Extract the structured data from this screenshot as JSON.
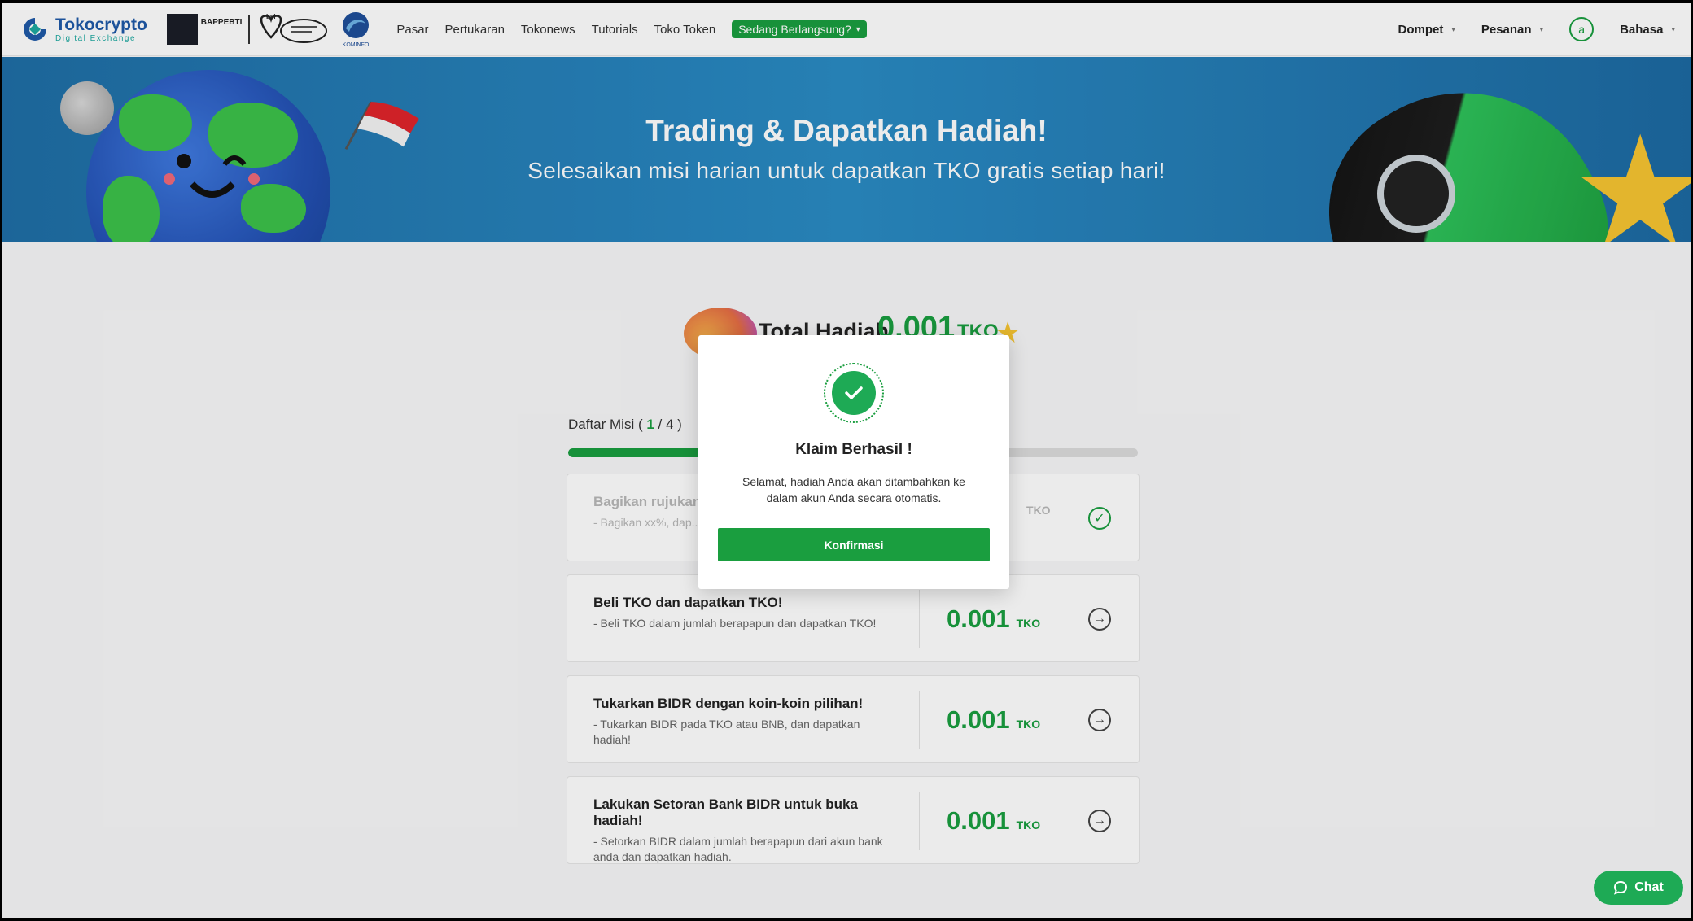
{
  "brand": {
    "name": "Tokocrypto",
    "subtitle": "Digital Exchange",
    "partner_bappebti": "BAPPEBTI",
    "partner_bsi": "bsi",
    "partner_kominfo": "KOMINFO"
  },
  "nav": {
    "links": [
      "Pasar",
      "Pertukaran",
      "Tokonews",
      "Tutorials",
      "Toko Token"
    ],
    "live_pill": "Sedang Berlangsung?",
    "wallet": "Dompet",
    "orders": "Pesanan",
    "avatar_letter": "a",
    "language": "Bahasa"
  },
  "banner": {
    "title": "Trading & Dapatkan Hadiah!",
    "subtitle": "Selesaikan misi harian untuk dapatkan TKO gratis setiap hari!"
  },
  "total": {
    "label": "Total Hadiah",
    "value": "0.001",
    "unit": "TKO"
  },
  "missions": {
    "count_label": "Daftar Misi",
    "completed": "1",
    "total": "4",
    "progress_fraction": 0.25,
    "items": [
      {
        "title": "Bagikan rujukan",
        "desc": "- Bagikan xx%, dap... dapat. Bagi. Dapat",
        "value": "",
        "unit": "TKO",
        "status": "done"
      },
      {
        "title": "Beli TKO dan dapatkan TKO!",
        "desc": "- Beli TKO dalam jumlah berapapun dan dapatkan TKO!",
        "value": "0.001",
        "unit": "TKO",
        "status": "open"
      },
      {
        "title": "Tukarkan BIDR dengan koin-koin pilihan!",
        "desc": "- Tukarkan BIDR pada TKO atau BNB, dan dapatkan hadiah!",
        "value": "0.001",
        "unit": "TKO",
        "status": "open"
      },
      {
        "title": "Lakukan Setoran Bank BIDR untuk buka hadiah!",
        "desc": "- Setorkan BIDR dalam jumlah berapapun dari akun bank anda dan dapatkan hadiah.",
        "value": "0.001",
        "unit": "TKO",
        "status": "open"
      }
    ]
  },
  "modal": {
    "title": "Klaim Berhasil !",
    "message": "Selamat, hadiah Anda akan ditambahkan ke dalam akun Anda secara otomatis.",
    "confirm": "Konfirmasi"
  },
  "chat": {
    "label": "Chat"
  },
  "colors": {
    "accent": "#1a9e3f",
    "banner": "#2a8bc4"
  }
}
